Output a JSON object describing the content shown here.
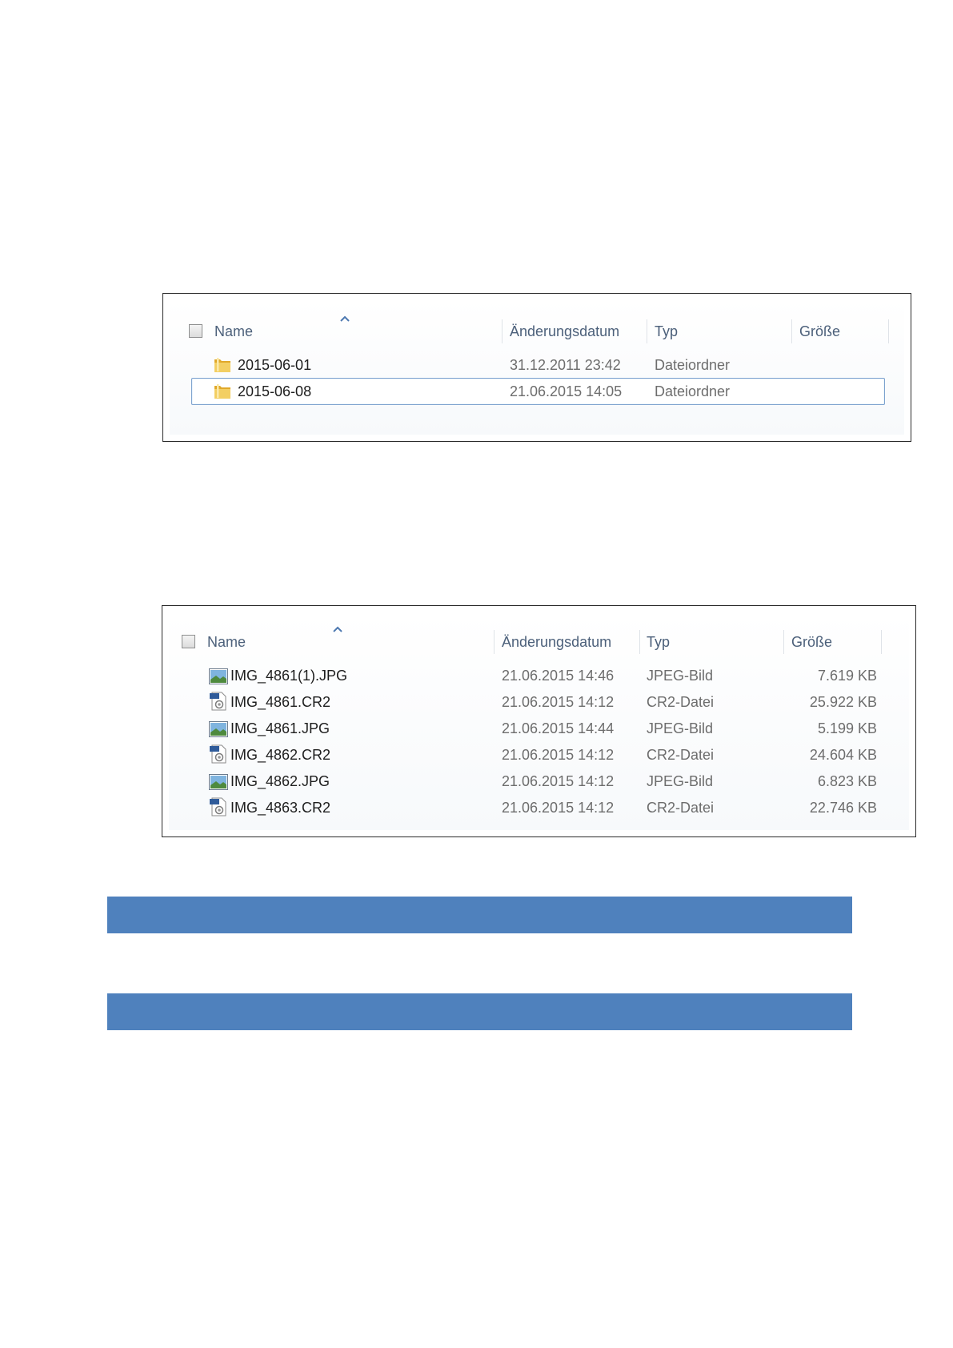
{
  "explorer_top": {
    "columns": {
      "name": "Name",
      "date": "Änderungsdatum",
      "type": "Typ",
      "size": "Größe"
    },
    "rows": [
      {
        "name": "2015-06-01",
        "date": "31.12.2011 23:42",
        "type": "Dateiordner",
        "size": "",
        "icon": "folder-icon",
        "selected": false
      },
      {
        "name": "2015-06-08",
        "date": "21.06.2015 14:05",
        "type": "Dateiordner",
        "size": "",
        "icon": "folder-icon",
        "selected": true
      }
    ]
  },
  "explorer_bottom": {
    "columns": {
      "name": "Name",
      "date": "Änderungsdatum",
      "type": "Typ",
      "size": "Größe"
    },
    "rows": [
      {
        "name": "IMG_4861(1).JPG",
        "date": "21.06.2015 14:46",
        "type": "JPEG-Bild",
        "size": "7.619 KB",
        "icon": "jpeg-image-icon"
      },
      {
        "name": "IMG_4861.CR2",
        "date": "21.06.2015 14:12",
        "type": "CR2-Datei",
        "size": "25.922 KB",
        "icon": "cr2-file-icon"
      },
      {
        "name": "IMG_4861.JPG",
        "date": "21.06.2015 14:44",
        "type": "JPEG-Bild",
        "size": "5.199 KB",
        "icon": "jpeg-image-icon"
      },
      {
        "name": "IMG_4862.CR2",
        "date": "21.06.2015 14:12",
        "type": "CR2-Datei",
        "size": "24.604 KB",
        "icon": "cr2-file-icon"
      },
      {
        "name": "IMG_4862.JPG",
        "date": "21.06.2015 14:12",
        "type": "JPEG-Bild",
        "size": "6.823 KB",
        "icon": "jpeg-image-icon"
      },
      {
        "name": "IMG_4863.CR2",
        "date": "21.06.2015 14:12",
        "type": "CR2-Datei",
        "size": "22.746 KB",
        "icon": "cr2-file-icon"
      }
    ]
  },
  "colors": {
    "band": "#4f81bd",
    "header_text": "#4c607a",
    "selection_border": "#7da2ce",
    "folder": "#e8b93b"
  }
}
